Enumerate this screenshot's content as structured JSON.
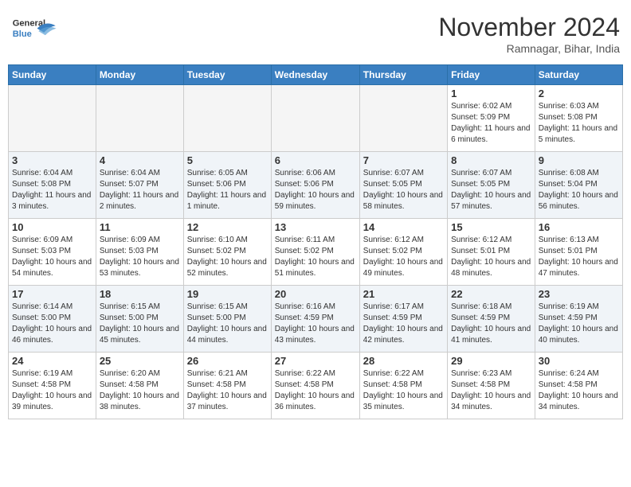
{
  "header": {
    "logo_line1": "General",
    "logo_line2": "Blue",
    "month": "November 2024",
    "location": "Ramnagar, Bihar, India"
  },
  "weekdays": [
    "Sunday",
    "Monday",
    "Tuesday",
    "Wednesday",
    "Thursday",
    "Friday",
    "Saturday"
  ],
  "weeks": [
    [
      {
        "date": "",
        "info": ""
      },
      {
        "date": "",
        "info": ""
      },
      {
        "date": "",
        "info": ""
      },
      {
        "date": "",
        "info": ""
      },
      {
        "date": "",
        "info": ""
      },
      {
        "date": "1",
        "info": "Sunrise: 6:02 AM\nSunset: 5:09 PM\nDaylight: 11 hours and 6 minutes."
      },
      {
        "date": "2",
        "info": "Sunrise: 6:03 AM\nSunset: 5:08 PM\nDaylight: 11 hours and 5 minutes."
      }
    ],
    [
      {
        "date": "3",
        "info": "Sunrise: 6:04 AM\nSunset: 5:08 PM\nDaylight: 11 hours and 3 minutes."
      },
      {
        "date": "4",
        "info": "Sunrise: 6:04 AM\nSunset: 5:07 PM\nDaylight: 11 hours and 2 minutes."
      },
      {
        "date": "5",
        "info": "Sunrise: 6:05 AM\nSunset: 5:06 PM\nDaylight: 11 hours and 1 minute."
      },
      {
        "date": "6",
        "info": "Sunrise: 6:06 AM\nSunset: 5:06 PM\nDaylight: 10 hours and 59 minutes."
      },
      {
        "date": "7",
        "info": "Sunrise: 6:07 AM\nSunset: 5:05 PM\nDaylight: 10 hours and 58 minutes."
      },
      {
        "date": "8",
        "info": "Sunrise: 6:07 AM\nSunset: 5:05 PM\nDaylight: 10 hours and 57 minutes."
      },
      {
        "date": "9",
        "info": "Sunrise: 6:08 AM\nSunset: 5:04 PM\nDaylight: 10 hours and 56 minutes."
      }
    ],
    [
      {
        "date": "10",
        "info": "Sunrise: 6:09 AM\nSunset: 5:03 PM\nDaylight: 10 hours and 54 minutes."
      },
      {
        "date": "11",
        "info": "Sunrise: 6:09 AM\nSunset: 5:03 PM\nDaylight: 10 hours and 53 minutes."
      },
      {
        "date": "12",
        "info": "Sunrise: 6:10 AM\nSunset: 5:02 PM\nDaylight: 10 hours and 52 minutes."
      },
      {
        "date": "13",
        "info": "Sunrise: 6:11 AM\nSunset: 5:02 PM\nDaylight: 10 hours and 51 minutes."
      },
      {
        "date": "14",
        "info": "Sunrise: 6:12 AM\nSunset: 5:02 PM\nDaylight: 10 hours and 49 minutes."
      },
      {
        "date": "15",
        "info": "Sunrise: 6:12 AM\nSunset: 5:01 PM\nDaylight: 10 hours and 48 minutes."
      },
      {
        "date": "16",
        "info": "Sunrise: 6:13 AM\nSunset: 5:01 PM\nDaylight: 10 hours and 47 minutes."
      }
    ],
    [
      {
        "date": "17",
        "info": "Sunrise: 6:14 AM\nSunset: 5:00 PM\nDaylight: 10 hours and 46 minutes."
      },
      {
        "date": "18",
        "info": "Sunrise: 6:15 AM\nSunset: 5:00 PM\nDaylight: 10 hours and 45 minutes."
      },
      {
        "date": "19",
        "info": "Sunrise: 6:15 AM\nSunset: 5:00 PM\nDaylight: 10 hours and 44 minutes."
      },
      {
        "date": "20",
        "info": "Sunrise: 6:16 AM\nSunset: 4:59 PM\nDaylight: 10 hours and 43 minutes."
      },
      {
        "date": "21",
        "info": "Sunrise: 6:17 AM\nSunset: 4:59 PM\nDaylight: 10 hours and 42 minutes."
      },
      {
        "date": "22",
        "info": "Sunrise: 6:18 AM\nSunset: 4:59 PM\nDaylight: 10 hours and 41 minutes."
      },
      {
        "date": "23",
        "info": "Sunrise: 6:19 AM\nSunset: 4:59 PM\nDaylight: 10 hours and 40 minutes."
      }
    ],
    [
      {
        "date": "24",
        "info": "Sunrise: 6:19 AM\nSunset: 4:58 PM\nDaylight: 10 hours and 39 minutes."
      },
      {
        "date": "25",
        "info": "Sunrise: 6:20 AM\nSunset: 4:58 PM\nDaylight: 10 hours and 38 minutes."
      },
      {
        "date": "26",
        "info": "Sunrise: 6:21 AM\nSunset: 4:58 PM\nDaylight: 10 hours and 37 minutes."
      },
      {
        "date": "27",
        "info": "Sunrise: 6:22 AM\nSunset: 4:58 PM\nDaylight: 10 hours and 36 minutes."
      },
      {
        "date": "28",
        "info": "Sunrise: 6:22 AM\nSunset: 4:58 PM\nDaylight: 10 hours and 35 minutes."
      },
      {
        "date": "29",
        "info": "Sunrise: 6:23 AM\nSunset: 4:58 PM\nDaylight: 10 hours and 34 minutes."
      },
      {
        "date": "30",
        "info": "Sunrise: 6:24 AM\nSunset: 4:58 PM\nDaylight: 10 hours and 34 minutes."
      }
    ]
  ]
}
